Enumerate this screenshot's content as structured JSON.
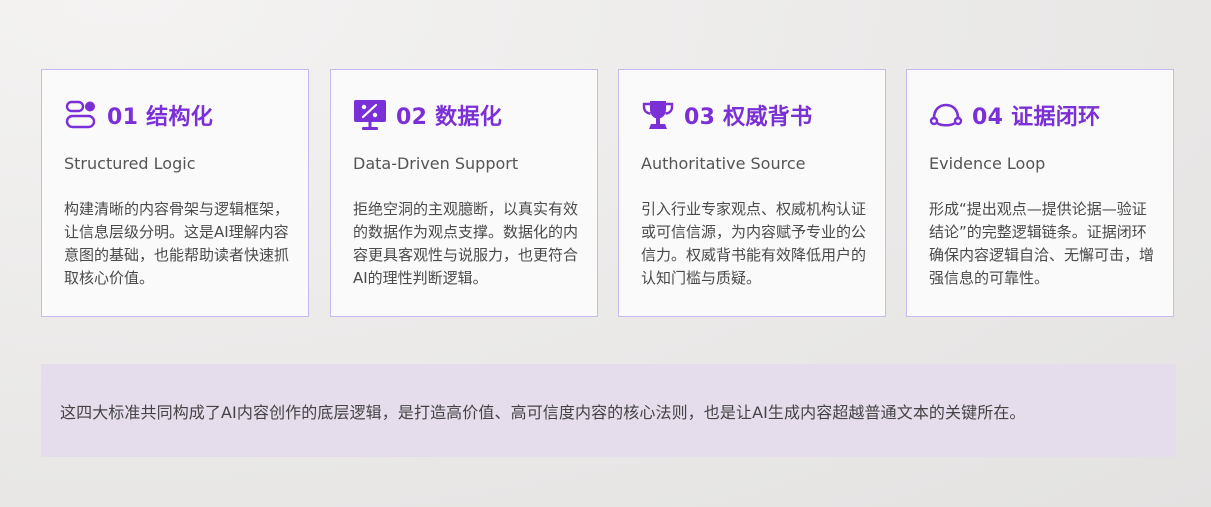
{
  "cards": [
    {
      "icon": "structure-blocks-icon",
      "title": "01 结构化",
      "subtitle": "Structured Logic",
      "body": "构建清晰的内容骨架与逻辑框架，让信息层级分明。这是AI理解内容意图的基础，也能帮助读者快速抓取核心价值。"
    },
    {
      "icon": "data-chart-icon",
      "title": "02 数据化",
      "subtitle": "Data-Driven Support",
      "body": "拒绝空洞的主观臆断，以真实有效的数据作为观点支撑。数据化的内容更具客观性与说服力，也更符合AI的理性判断逻辑。"
    },
    {
      "icon": "trophy-icon",
      "title": "03 权威背书",
      "subtitle": "Authoritative Source",
      "body": "引入行业专家观点、权威机构认证或可信信源，为内容赋予专业的公信力。权威背书能有效降低用户的认知门槛与质疑。"
    },
    {
      "icon": "loop-icon",
      "title": "04 证据闭环",
      "subtitle": "Evidence Loop",
      "body": "形成“提出观点—提供论据—验证结论”的完整逻辑链条。证据闭环确保内容逻辑自洽、无懈可击，增强信息的可靠性。"
    }
  ],
  "summary": "这四大标准共同构成了AI内容创作的底层逻辑，是打造高价值、高可信度内容的核心法则，也是让AI生成内容超越普通文本的关键所在。",
  "colors": {
    "accent": "#7b2fd6",
    "card_border": "#c9b9ee",
    "summary_bg": "#e5dcec"
  }
}
